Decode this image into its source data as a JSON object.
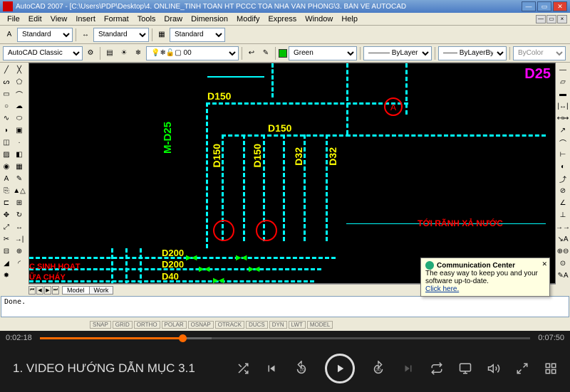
{
  "acad": {
    "title": "AutoCAD 2007 - [C:\\Users\\PDP\\Desktop\\4. ONLINE_TÍNH TOÁN HT PCCC             TÒA NHÀ VĂN PHÒNG\\3. BẢN VẼ AUTOCAD",
    "menu": [
      "File",
      "Edit",
      "View",
      "Insert",
      "Format",
      "Tools",
      "Draw",
      "Dimension",
      "Modify",
      "Express",
      "Window",
      "Help"
    ],
    "style_selects": {
      "s1": "Standard",
      "s2": "Standard",
      "s3": "Standard"
    },
    "layer_select": "AutoCAD Classic",
    "layer2": "0",
    "color_select": "Green",
    "linetype_select": "ByLayer",
    "lineweight_select": "ByLayer",
    "plotstyle_select": "ByColor",
    "tabs": {
      "active": "Model",
      "other": "Work"
    },
    "cmd": "Done.",
    "status_coords": "",
    "status_modes": [
      "SNAP",
      "GRID",
      "ORTHO",
      "POLAR",
      "OSNAP",
      "OTRACK",
      "DUCS",
      "DYN",
      "LWT",
      "MODEL"
    ],
    "comm": {
      "title": "Communication Center",
      "msg": "The easy way to keep you and your software up-to-date.",
      "link": "Click here."
    },
    "drawing": {
      "text_d25_right": "D25",
      "text_d150_top": "D150",
      "text_d150_mid": "D150",
      "text_md25": "M-D25",
      "text_d150_v1": "D150",
      "text_d150_v2": "D150",
      "text_d32_v1": "D32",
      "text_d32_v2": "D32",
      "text_d200_1": "D200",
      "text_d200_2": "D200",
      "text_d40": "D40",
      "text_ranh": "TỚI RÃNH XẢ NƯỚC",
      "text_sinhhoat": "C SINH HOẠT",
      "text_chay": "ỮA CHÁY"
    }
  },
  "player": {
    "title": "1. VIDEO HƯỚNG DẪN MỤC 3.1",
    "time_elapsed": "0:02:18",
    "time_total": "0:07:50",
    "progress_pct": 29
  }
}
